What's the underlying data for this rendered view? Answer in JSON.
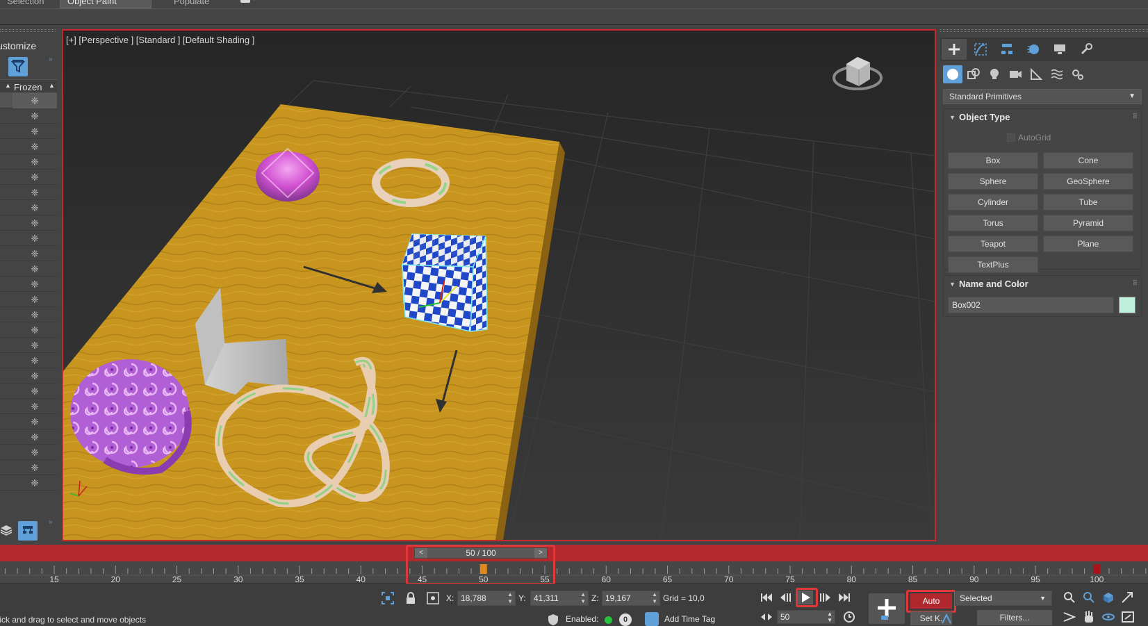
{
  "ribbon": {
    "tabs": [
      "Selection",
      "Object Paint",
      "Populate"
    ],
    "active_tab": "Object Paint"
  },
  "explorer": {
    "title": "Customize",
    "column_header": "Frozen",
    "row_count": 26
  },
  "viewport": {
    "label": "[+] [Perspective ] [Standard ] [Default Shading ]",
    "highlight_color": "#c8272b"
  },
  "command_panel": {
    "category_dropdown": "Standard Primitives",
    "object_type": {
      "title": "Object Type",
      "autogrid_label": "AutoGrid",
      "buttons": [
        "Box",
        "Cone",
        "Sphere",
        "GeoSphere",
        "Cylinder",
        "Tube",
        "Torus",
        "Pyramid",
        "Teapot",
        "Plane",
        "TextPlus"
      ]
    },
    "name_and_color": {
      "title": "Name and Color",
      "name_value": "Box002",
      "swatch_color": "#bff0dc"
    }
  },
  "timeline": {
    "slider_text": "50 / 100",
    "prev_label": "<",
    "next_label": ">",
    "ticks": [
      "15",
      "20",
      "25",
      "30",
      "35",
      "40",
      "45",
      "50",
      "55",
      "60",
      "65",
      "70",
      "75",
      "80",
      "85",
      "90",
      "95",
      "100"
    ],
    "current_frame": 50
  },
  "status": {
    "prompt": "Click and drag to select and move objects",
    "x_label": "X:",
    "x_value": "18,788",
    "y_label": "Y:",
    "y_value": "41,311",
    "z_label": "Z:",
    "z_value": "19,167",
    "grid": "Grid = 10,0",
    "enabled_label": "Enabled:",
    "enabled_count": "0",
    "time_tag": "Add Time Tag",
    "frame_value": "50",
    "auto_label": "Auto",
    "setkey_label": "Set K.",
    "selected_label": "Selected",
    "filters_label": "Filters..."
  }
}
